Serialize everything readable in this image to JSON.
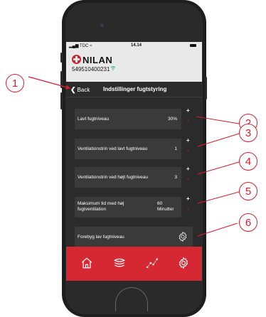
{
  "status_bar": {
    "carrier": "TDC",
    "time": "14.14"
  },
  "brand": {
    "logo_text": "NILAN",
    "serial": "549510400231"
  },
  "nav": {
    "back_label": "Back",
    "title": "Indstillinger fugtstyring"
  },
  "settings": [
    {
      "label": "Lavt fugtniveau",
      "value": "30%"
    },
    {
      "label": "Ventilationstrin ved lavt fugtniveau",
      "value": "1"
    },
    {
      "label": "Ventilationstrin ved højt fugtniveau",
      "value": "3"
    },
    {
      "label": "Maksimum tid med høj fugtventilation",
      "value": "60 Minutter"
    },
    {
      "label": "Forebyg lav fugtniveau",
      "icon": "gear-icon"
    }
  ],
  "stepper": {
    "plus": "+",
    "minus": "-"
  },
  "tabs": [
    {
      "icon": "home-icon"
    },
    {
      "icon": "layers-icon"
    },
    {
      "icon": "graph-icon"
    },
    {
      "icon": "gear-icon"
    }
  ],
  "callouts": [
    "1",
    "2",
    "3",
    "4",
    "5",
    "6"
  ],
  "colors": {
    "accent": "#d4202f",
    "tabbar": "#d62833",
    "screen_bg": "#2b2b2b",
    "row_bg": "#3a3a3a"
  }
}
